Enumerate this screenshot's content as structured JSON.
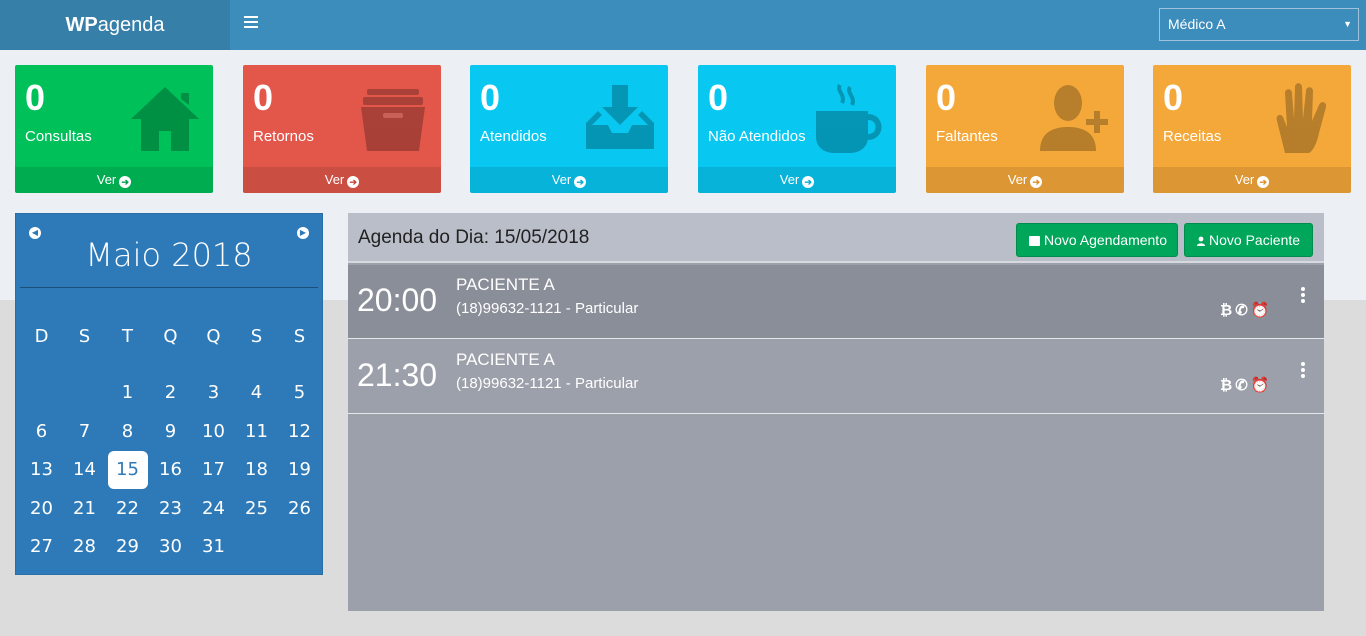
{
  "header": {
    "logo_bold": "WP",
    "logo_rest": "agenda",
    "doctor_select": "Médico A"
  },
  "stats": [
    {
      "value": "0",
      "label": "Consultas",
      "link": "Ver",
      "color": "#00c05a",
      "icon": "home-icon"
    },
    {
      "value": "0",
      "label": "Retornos",
      "link": "Ver",
      "color": "#e3574b",
      "icon": "archive-icon"
    },
    {
      "value": "0",
      "label": "Atendidos",
      "link": "Ver",
      "color": "#08c8f2",
      "icon": "inbox-download-icon"
    },
    {
      "value": "0",
      "label": "Não Atendidos",
      "link": "Ver",
      "color": "#08c8f2",
      "icon": "coffee-cup-icon"
    },
    {
      "value": "0",
      "label": "Faltantes",
      "link": "Ver",
      "color": "#f5a83a",
      "icon": "user-add-icon"
    },
    {
      "value": "0",
      "label": "Receitas",
      "link": "Ver",
      "color": "#f5a83a",
      "icon": "hand-icon"
    }
  ],
  "calendar": {
    "title": "Maio 2018",
    "weekdays": [
      "D",
      "S",
      "T",
      "Q",
      "Q",
      "S",
      "S"
    ],
    "weeks": [
      [
        "",
        "",
        "1",
        "2",
        "3",
        "4",
        "5"
      ],
      [
        "6",
        "7",
        "8",
        "9",
        "10",
        "11",
        "12"
      ],
      [
        "13",
        "14",
        "15",
        "16",
        "17",
        "18",
        "19"
      ],
      [
        "20",
        "21",
        "22",
        "23",
        "24",
        "25",
        "26"
      ],
      [
        "27",
        "28",
        "29",
        "30",
        "31",
        "",
        ""
      ]
    ],
    "today": "15"
  },
  "agenda": {
    "title": "Agenda do Dia: 15/05/2018",
    "new_appointment": "Novo Agendamento",
    "new_patient": "Novo Paciente",
    "appointments": [
      {
        "time": "20:00",
        "name": "PACIENTE A",
        "info": "(18)99632-1121 - Particular"
      },
      {
        "time": "21:30",
        "name": "PACIENTE A",
        "info": "(18)99632-1121 - Particular"
      }
    ]
  },
  "colors": {
    "topbar": "#3c8dbc",
    "calendar": "#2e7ab8",
    "button_green": "#00a65a"
  }
}
